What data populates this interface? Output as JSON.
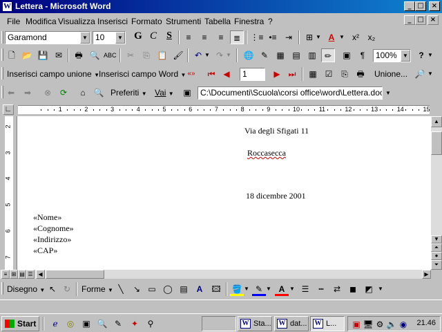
{
  "window": {
    "title": "Lettera - Microsoft Word",
    "app_icon": "W",
    "controls": [
      "_",
      "□",
      "×"
    ]
  },
  "menu": [
    "File",
    "Modifica",
    "Visualizza",
    "Inserisci",
    "Formato",
    "Strumenti",
    "Tabella",
    "Finestra",
    "?"
  ],
  "formatting": {
    "font_name": "Garamond",
    "font_size": "10",
    "bold": "G",
    "italic": "C",
    "underline": "S"
  },
  "standard": {
    "zoom": "100%",
    "help": "?"
  },
  "mail_merge": {
    "insert_merge_field": "Inserisci campo unione",
    "insert_word_field": "Inserisci campo Word",
    "view_merged": "«»",
    "record_number": "1",
    "merge_label": "Unione..."
  },
  "web": {
    "favorites": "Preferiti",
    "go": "Vai",
    "address": "C:\\Documenti\\Scuola\\corsi office\\word\\Lettera.doc"
  },
  "ruler": {
    "numbers": [
      "1",
      "2",
      "3",
      "4",
      "5",
      "6",
      "7",
      "8",
      "9",
      "10",
      "11",
      "12",
      "13",
      "14",
      "15"
    ],
    "vnumbers": [
      "2",
      "3",
      "4",
      "5",
      "6",
      "7"
    ]
  },
  "document": {
    "street": "Via degli Sfigati 11",
    "city": "Roccasecca",
    "date": "18 dicembre 2001",
    "fields": [
      "«Nome»",
      "«Cognome»",
      "«Indirizzo»",
      "«CAP»"
    ]
  },
  "drawing": {
    "draw_label": "Disegno",
    "shapes_label": "Forme"
  },
  "taskbar": {
    "start": "Start",
    "tasks": [
      "Sta...",
      "dat...",
      "L..."
    ],
    "clock": "21.46"
  },
  "colors": {
    "titlebar": "#000080",
    "face": "#c0c0c0"
  }
}
